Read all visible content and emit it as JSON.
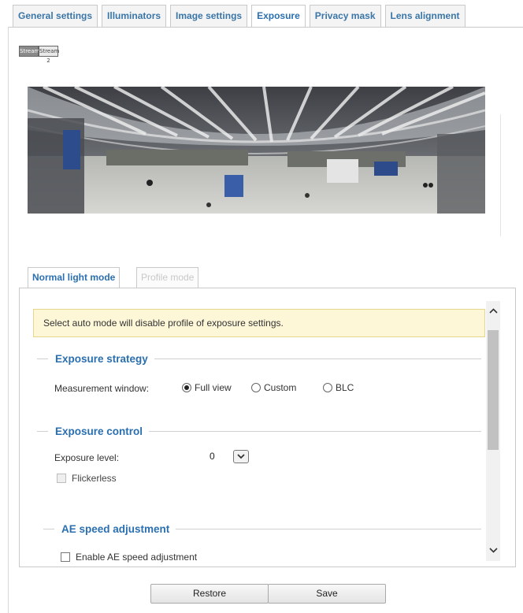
{
  "top_tabs": [
    {
      "label": "General settings",
      "active": false
    },
    {
      "label": "Illuminators",
      "active": false
    },
    {
      "label": "Image settings",
      "active": false
    },
    {
      "label": "Exposure",
      "active": true
    },
    {
      "label": "Privacy mask",
      "active": false
    },
    {
      "label": "Lens alignment",
      "active": false
    }
  ],
  "stream_buttons": [
    {
      "label": "Stream 1",
      "active": true
    },
    {
      "label": "Stream 2",
      "active": false
    }
  ],
  "mode_tabs": {
    "normal": "Normal light mode",
    "profile": "Profile mode"
  },
  "notice": "Select auto mode will disable profile of exposure settings.",
  "exposure_strategy": {
    "title": "Exposure strategy",
    "measurement_label": "Measurement window:",
    "options": [
      {
        "label": "Full view",
        "selected": true
      },
      {
        "label": "Custom",
        "selected": false
      },
      {
        "label": "BLC",
        "selected": false
      }
    ]
  },
  "exposure_control": {
    "title": "Exposure control",
    "level_label": "Exposure level:",
    "level_value": "0",
    "flickerless_label": "Flickerless",
    "flickerless_checked": false,
    "flickerless_enabled": false
  },
  "ae_speed": {
    "title": "AE speed adjustment",
    "enable_label": "Enable AE speed adjustment",
    "enable_checked": false
  },
  "buttons": {
    "restore": "Restore",
    "save": "Save"
  },
  "icons": {
    "scroll_up": "chevron-up-icon",
    "scroll_down": "chevron-down-icon",
    "select_arrow": "chevron-down-icon"
  },
  "colors": {
    "accent": "#2a6fb0",
    "notice_bg": "#fdf7d8"
  }
}
